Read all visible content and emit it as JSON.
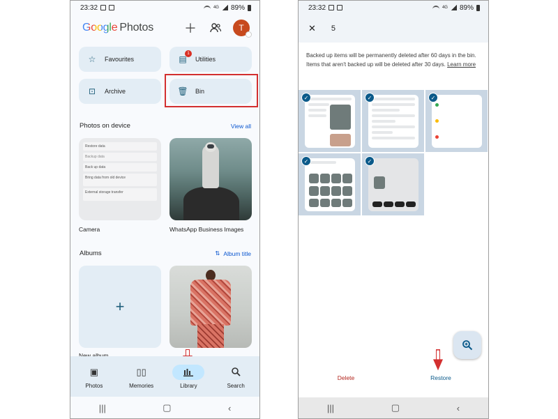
{
  "left": {
    "status": {
      "time": "23:32",
      "battery": "89%",
      "network": "4G"
    },
    "header": {
      "logo_google": "Google",
      "logo_photos": "Photos",
      "avatar_letter": "T"
    },
    "tiles": {
      "favourites": "Favourites",
      "utilities": "Utilities",
      "utilities_badge": "1",
      "archive": "Archive",
      "bin": "Bin"
    },
    "photos_on_device": {
      "title": "Photos on device",
      "view_all": "View all",
      "camera_label": "Camera",
      "whatsapp_label": "WhatsApp Business Images",
      "camera_rows": [
        "Restore data",
        "Backup data",
        "Back up data",
        "Bring data from old device",
        "External storage transfer"
      ]
    },
    "albums": {
      "title": "Albums",
      "sort_label": "Album title",
      "new_album": "New album"
    },
    "nav": {
      "photos": "Photos",
      "memories": "Memories",
      "library": "Library",
      "search": "Search"
    }
  },
  "right": {
    "status": {
      "time": "23:32",
      "battery": "89%",
      "network": "4G"
    },
    "selection_count": "5",
    "info_text": "Backed up items will be permanently deleted after 60 days in the bin. Items that aren't backed up will be deleted after 30 days.",
    "learn_more": "Learn more",
    "actions": {
      "delete": "Delete",
      "restore": "Restore"
    }
  },
  "colors": {
    "accent": "#0b57d0",
    "tile_bg": "#e3edf5",
    "highlight_red": "#d32f2f",
    "avatar": "#c74a1e",
    "check": "#0b5a8a"
  }
}
